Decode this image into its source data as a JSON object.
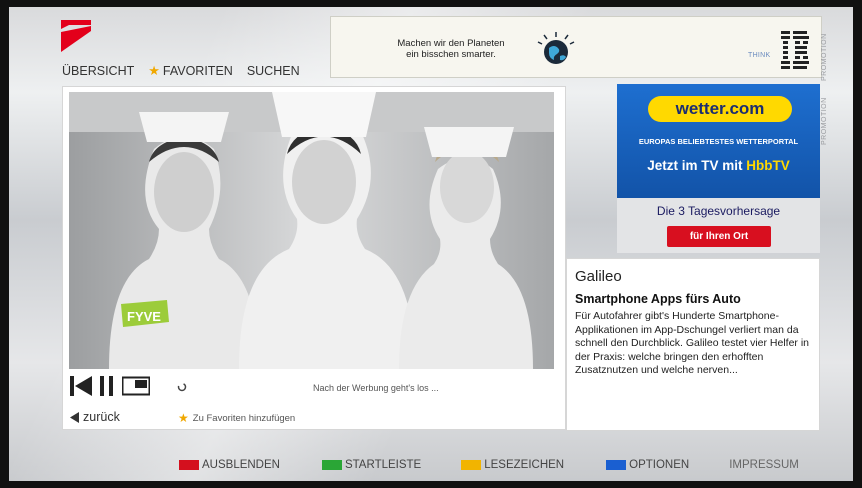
{
  "nav": {
    "overview": "ÜBERSICHT",
    "favorites": "FAVORITEN",
    "search": "SUCHEN"
  },
  "banner": {
    "line1": "Machen wir den Planeten",
    "line2": "ein bisschen smarter.",
    "think": "THINK",
    "brand": "IBM",
    "promotion": "PROMOTION"
  },
  "promotion2": "PROMOTION",
  "video": {
    "overlay_logo": "FYVE",
    "status_message": "Nach der Werbung geht's los ...",
    "back_label": "zurück",
    "add_favorite_label": "Zu Favoriten hinzufügen"
  },
  "weather_ad": {
    "logo": "wetter.com",
    "tagline": "EUROPAS BELIEBTESTES WETTERPORTAL",
    "tv_prefix": "Jetzt im TV mit ",
    "tv_hbb": "HbbTV",
    "forecast": "Die 3 Tagesvorhersage",
    "button": "für Ihren Ort"
  },
  "article": {
    "source": "Galileo",
    "title": "Smartphone Apps fürs Auto",
    "body": "Für Autofahrer gibt's Hunderte Smartphone-Applikationen im App-Dschungel verliert man da schnell den Durchblick. Galileo testet vier Helfer in der Praxis: welche bringen den erhofften Zusatznutzen und welche nerven..."
  },
  "bottom_bar": {
    "items": [
      {
        "label": "AUSBLENDEN",
        "color": "#d4101e"
      },
      {
        "label": "STARTLEISTE",
        "color": "#2aa636"
      },
      {
        "label": "LESEZEICHEN",
        "color": "#f2b400"
      },
      {
        "label": "OPTIONEN",
        "color": "#1a5fd1"
      }
    ],
    "impressum": "IMPRESSUM"
  },
  "colors": {
    "accent_red": "#e3001b",
    "star": "#f0a800"
  }
}
